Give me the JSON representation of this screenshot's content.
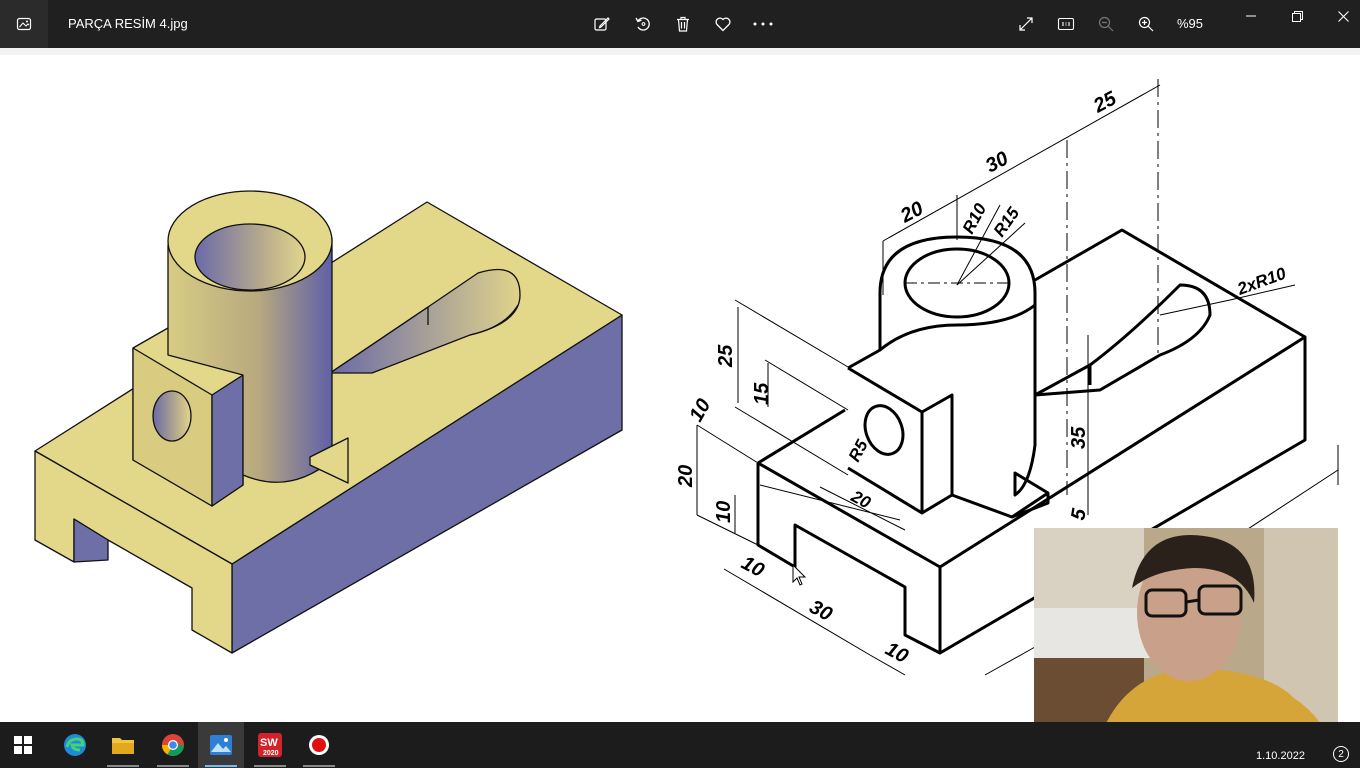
{
  "window": {
    "file_name": "PARÇA RESİM 4.jpg",
    "zoom": "%95"
  },
  "toolbar": {
    "icons": [
      "edit-image-icon",
      "rotate-icon",
      "delete-icon",
      "favorite-icon",
      "more-icon"
    ],
    "right_icons": [
      "fullscreen-icon",
      "actual-size-icon",
      "zoom-out-icon",
      "zoom-in-icon"
    ]
  },
  "drawing": {
    "dimensions": {
      "d25_top": "25",
      "d30_top": "30",
      "d20_top": "20",
      "r10": "R10",
      "r15": "R15",
      "slot": "2xR10",
      "d25_left": "25",
      "d15_left": "15",
      "d10_left": "10",
      "d20_left": "20",
      "d10_left2": "10",
      "r5": "R5",
      "d20_mid": "20",
      "d35": "35",
      "d5": "5",
      "d10_bottom": "10",
      "d30_bottom": "30",
      "d10_bottom2": "10"
    },
    "colors": {
      "top_face": "#e3d78a",
      "side_face": "#6e6fa6",
      "outline": "#000000"
    }
  },
  "taskbar": {
    "apps": [
      "windows-start",
      "edge",
      "file-explorer",
      "chrome",
      "photos",
      "solidworks-2020",
      "recorder"
    ],
    "date": "1.10.2022",
    "notifications": "2"
  }
}
